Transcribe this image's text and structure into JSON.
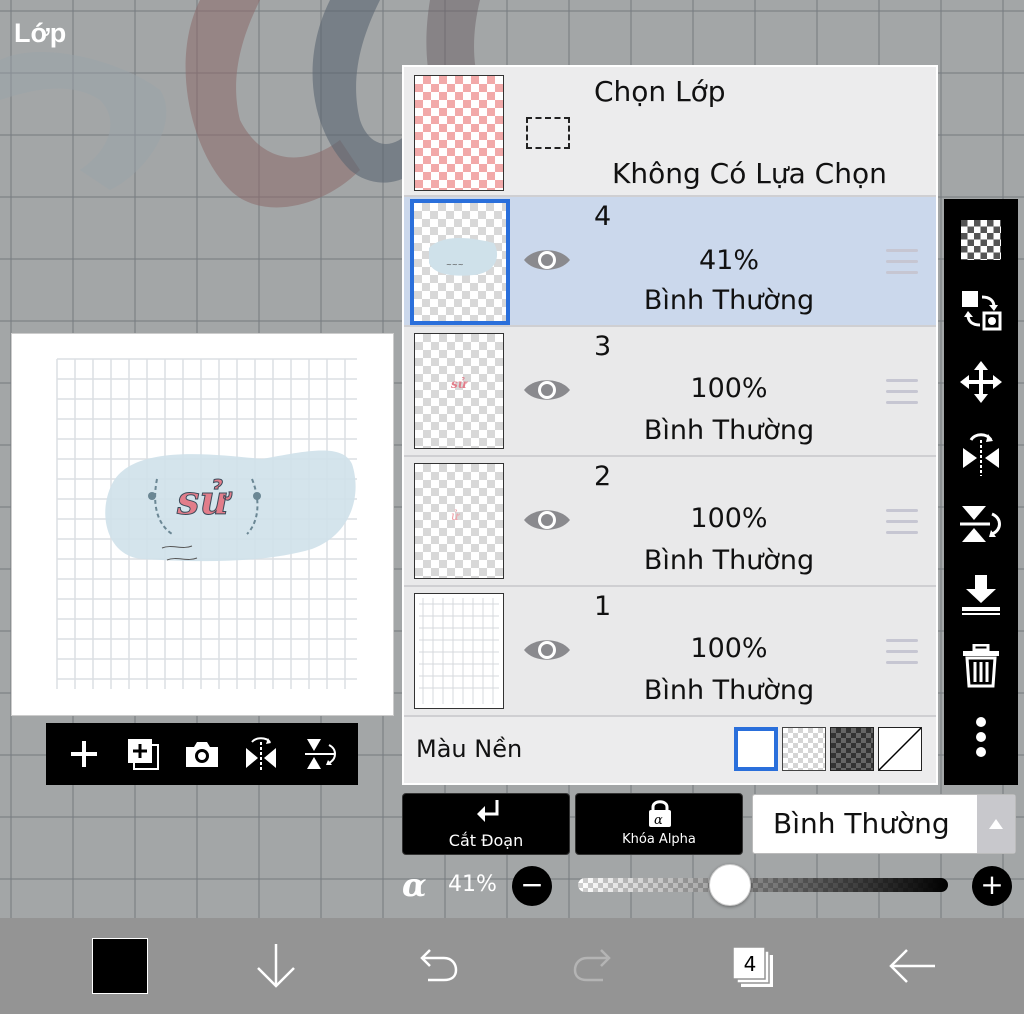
{
  "panel": {
    "title": "Lớp"
  },
  "selection_row": {
    "title": "Chọn Lớp",
    "status": "Không Có Lựa Chọn"
  },
  "layers": [
    {
      "number": "4",
      "opacity": "41%",
      "blend_mode": "Bình Thường",
      "selected": true
    },
    {
      "number": "3",
      "opacity": "100%",
      "blend_mode": "Bình Thường",
      "selected": false
    },
    {
      "number": "2",
      "opacity": "100%",
      "blend_mode": "Bình Thường",
      "selected": false
    },
    {
      "number": "1",
      "opacity": "100%",
      "blend_mode": "Bình Thường",
      "selected": false
    }
  ],
  "background": {
    "label": "Màu Nền",
    "options": [
      "white",
      "checker",
      "dark-checker",
      "none"
    ],
    "selected": "white"
  },
  "controls": {
    "clip_label": "Cắt Đoạn",
    "alpha_lock_label": "Khóa Alpha",
    "blend_mode_value": "Bình Thường"
  },
  "opacity_slider": {
    "symbol": "α",
    "value_text": "41%",
    "value": 0.41
  },
  "preview_tools": [
    "add-layer-icon",
    "add-copy-icon",
    "camera-icon",
    "flip-horizontal-icon",
    "flip-vertical-icon"
  ],
  "right_tools": [
    "transparency-icon",
    "swap-layer-icon",
    "move-icon",
    "flip-horizontal-icon",
    "flip-vertical-icon",
    "merge-down-icon",
    "trash-icon",
    "more-icon"
  ],
  "bottom_bar": {
    "layer_count": "4",
    "items": [
      "color-swatch",
      "download-icon",
      "undo-icon",
      "redo-icon",
      "layers-icon",
      "back-icon"
    ]
  },
  "colors": {
    "accent": "#2a6fdb",
    "selected_row": "#cbd8ec",
    "toolbar": "#000000",
    "current_color": "#000000"
  },
  "preview_art": {
    "text": "sử"
  }
}
